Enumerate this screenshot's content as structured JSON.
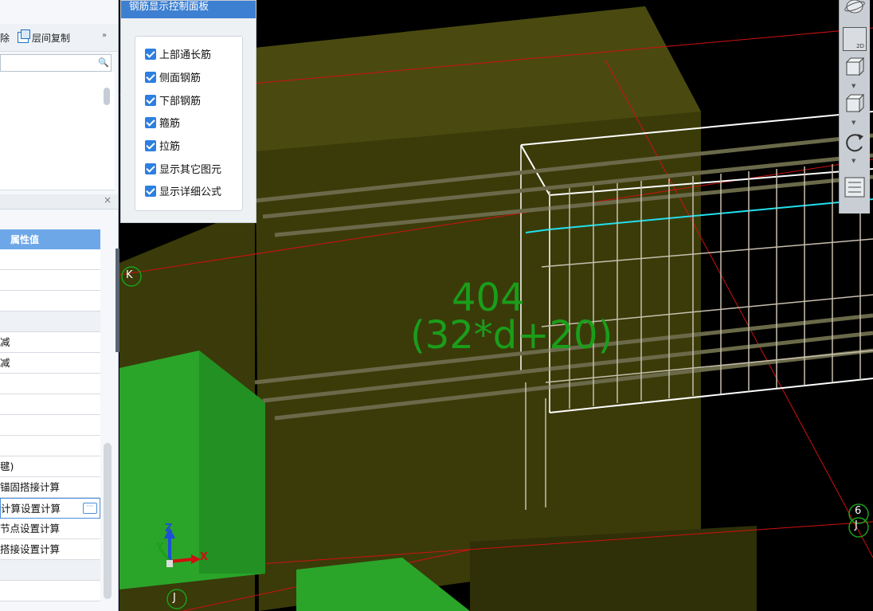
{
  "toolbar": {
    "delete_partial": "除",
    "layer_copy": "层间复制",
    "more": "»"
  },
  "tree_panel": {
    "close": "×"
  },
  "property_grid": {
    "header": "属性值",
    "rows": [
      "",
      "",
      "",
      "",
      "减",
      "减",
      "",
      "",
      "",
      "",
      "毽)",
      "锚固搭接计算",
      "计算设置计算",
      "节点设置计算",
      "搭接设置计算",
      "",
      ""
    ],
    "selected_row_button": "···"
  },
  "rebar_panel": {
    "title": "钢筋显示控制面板",
    "options": [
      {
        "label": "上部通长筋",
        "checked": true
      },
      {
        "label": "侧面钢筋",
        "checked": true
      },
      {
        "label": "下部钢筋",
        "checked": true
      },
      {
        "label": "箍筋",
        "checked": true
      },
      {
        "label": "拉筋",
        "checked": true
      },
      {
        "label": "显示其它图元",
        "checked": true
      },
      {
        "label": "显示详细公式",
        "checked": true
      }
    ]
  },
  "viewport": {
    "length_value": "404",
    "length_formula": "(32*d+20)",
    "grid_labels": {
      "k": "K",
      "j_bottom": "J",
      "right_top": "6",
      "right_bottom": "J"
    },
    "axes": {
      "z": "Z",
      "y": "Y",
      "x": "X"
    }
  },
  "view_toolbar": {
    "btn_2d": "2D"
  },
  "colors": {
    "accent": "#3d7fd1",
    "concrete": "#4a4a0c",
    "column_green": "#2aa52a",
    "axis_red": "#d01010",
    "highlight_cyan": "#22e0ee",
    "dimension_green": "#1a9e1a"
  }
}
